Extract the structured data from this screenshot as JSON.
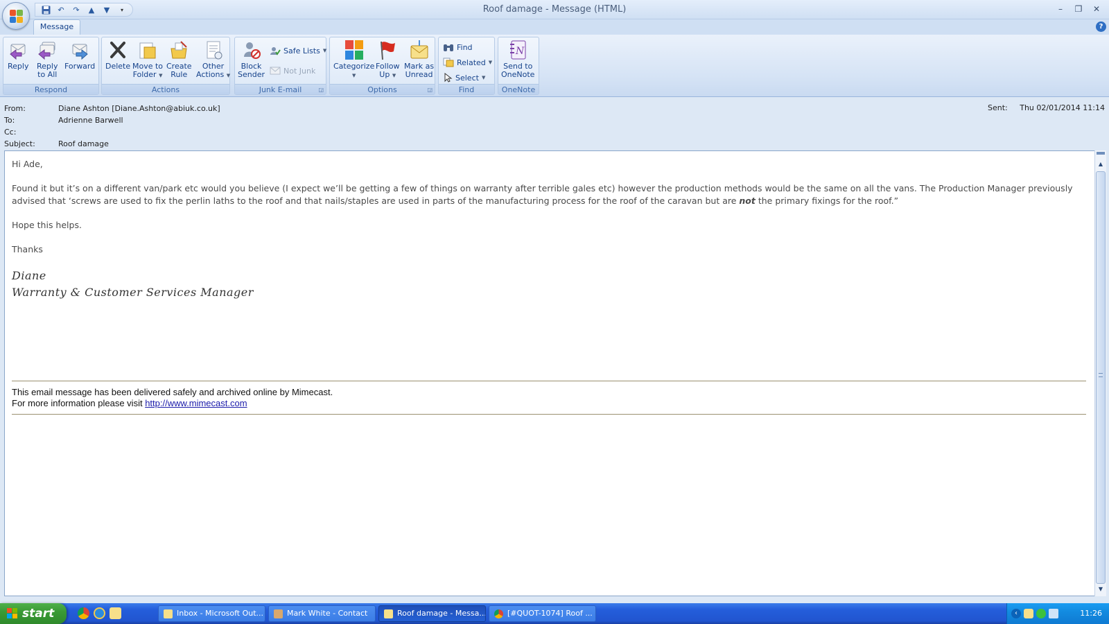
{
  "window": {
    "title": "Roof damage - Message (HTML)"
  },
  "ribbon": {
    "tab": "Message",
    "groups": {
      "respond": "Respond",
      "actions": "Actions",
      "junk": "Junk E-mail",
      "options": "Options",
      "find": "Find",
      "onenote": "OneNote"
    },
    "buttons": {
      "reply": "Reply",
      "reply_all_1": "Reply",
      "reply_all_2": "to All",
      "forward": "Forward",
      "delete": "Delete",
      "move_1": "Move to",
      "move_2": "Folder",
      "rule_1": "Create",
      "rule_2": "Rule",
      "other_1": "Other",
      "other_2": "Actions",
      "block_1": "Block",
      "block_2": "Sender",
      "safe_lists": "Safe Lists",
      "not_junk": "Not Junk",
      "categorize": "Categorize",
      "follow_1": "Follow",
      "follow_2": "Up",
      "mark_1": "Mark as",
      "mark_2": "Unread",
      "find": "Find",
      "related": "Related",
      "select": "Select",
      "onenote_1": "Send to",
      "onenote_2": "OneNote"
    }
  },
  "header": {
    "from_label": "From:",
    "from_value": "Diane Ashton [Diane.Ashton@abiuk.co.uk]",
    "to_label": "To:",
    "to_value": "Adrienne Barwell",
    "cc_label": "Cc:",
    "cc_value": "",
    "subject_label": "Subject:",
    "subject_value": "Roof damage",
    "sent_label": "Sent:",
    "sent_value": "Thu 02/01/2014 11:14"
  },
  "body": {
    "greeting": "Hi Ade,",
    "para1_a": "Found it but it’s on a different van/park etc would you believe (I expect we’ll be getting a few of things on warranty after terrible gales etc)  however the production methods would be the same on all the vans. The Production Manager previously advised that  ‘screws are used to fix the perlin laths to the roof and that nails/staples are used in parts of the manufacturing process for the roof of the caravan but are ",
    "para1_em": "not",
    "para1_b": " the primary fixings for the roof.”",
    "para2": "Hope this helps.",
    "para3": "Thanks",
    "sig_name": "Diane",
    "sig_title": "Warranty & Customer Services Manager",
    "footer_line1": "This email message has been delivered safely and archived online by Mimecast.",
    "footer_line2": "For more information please visit ",
    "footer_link": "http://www.mimecast.com"
  },
  "taskbar": {
    "start": "start",
    "tasks": [
      "Inbox - Microsoft Out...",
      "Mark White - Contact",
      "Roof damage - Messa...",
      "[#QUOT-1074] Roof ..."
    ],
    "clock": "11:26"
  }
}
